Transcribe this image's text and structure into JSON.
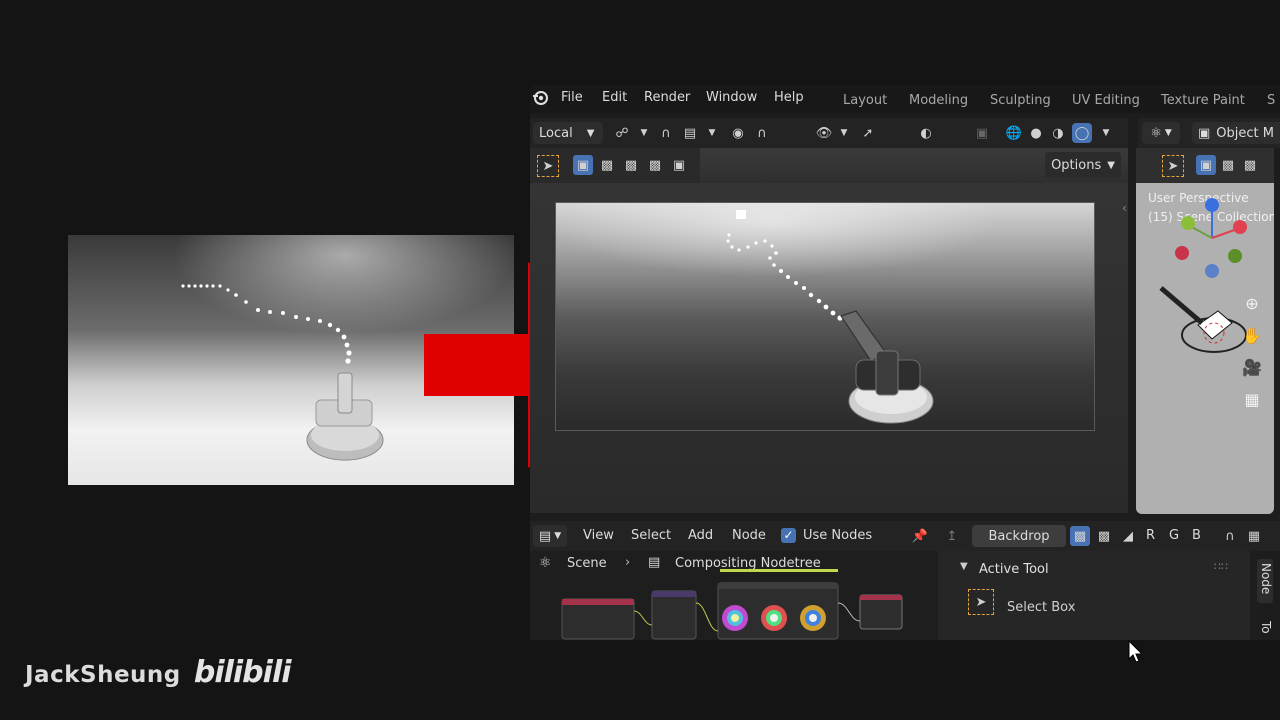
{
  "menu": {
    "items": [
      "File",
      "Edit",
      "Render",
      "Window",
      "Help"
    ]
  },
  "workspaces": {
    "tabs": [
      "Layout",
      "Modeling",
      "Sculpting",
      "UV Editing",
      "Texture Paint",
      "S"
    ]
  },
  "viewport_header": {
    "transform_orientation": "Local",
    "options_label": "Options"
  },
  "side_viewport": {
    "header_mode": "Object M",
    "perspective_label": "User Perspective",
    "collection_label": "(15) Scene Collection"
  },
  "node_editor": {
    "menus": [
      "View",
      "Select",
      "Add",
      "Node"
    ],
    "use_nodes_label": "Use Nodes",
    "use_nodes_checked": true,
    "backdrop_label": "Backdrop",
    "channels": [
      "R",
      "G",
      "B"
    ],
    "breadcrumb_scene": "Scene",
    "breadcrumb_tree": "Compositing Nodetree"
  },
  "sidebar": {
    "panel_title": "Active Tool",
    "tool_name": "Select Box",
    "tabs": [
      "Node",
      "To"
    ]
  },
  "watermark": {
    "author": "JackSheung",
    "platform": "bilibili"
  },
  "colors": {
    "arrow": "#e00000",
    "accent_blue": "#4772b3",
    "select_orange": "#e8a33c"
  }
}
